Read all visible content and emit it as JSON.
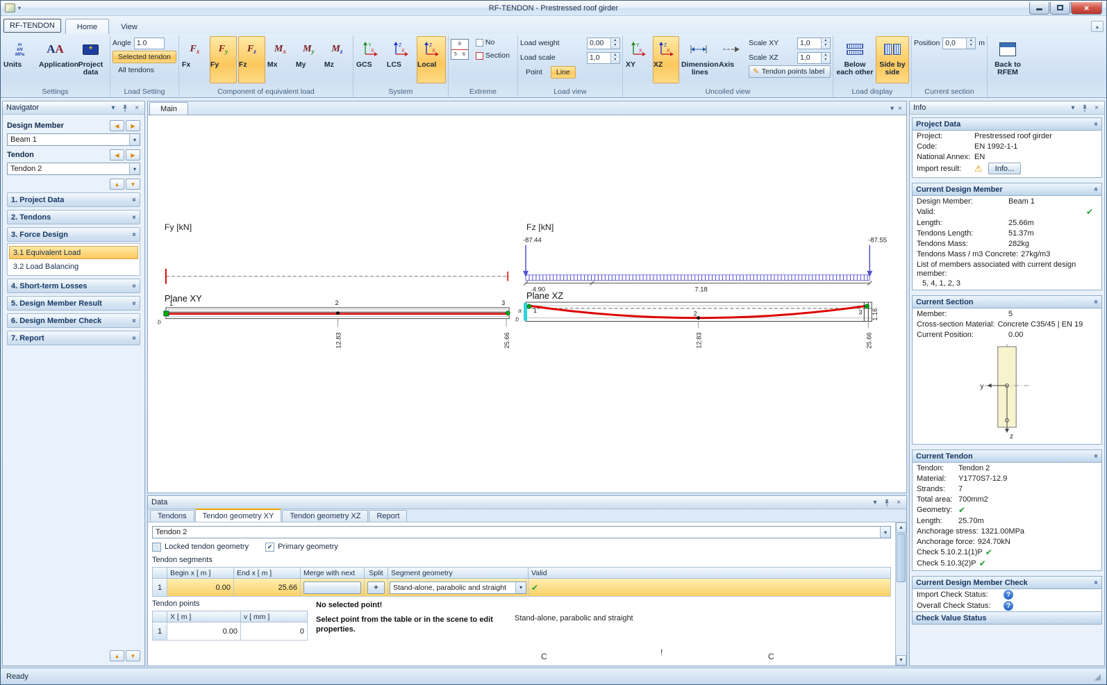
{
  "icons": {
    "chevron_down": "▾",
    "chevron_up": "▴",
    "close": "×",
    "check": "✔",
    "warning": "⚠",
    "question": "?",
    "plus": "+",
    "spin_up": "▴",
    "spin_down": "▾",
    "nav_left": "◀",
    "nav_right": "▶",
    "nav_up": "▲",
    "nav_down": "▼",
    "chevron_double": "»",
    "grip": "◢",
    "pencil": "✎",
    "star": "*"
  },
  "titlebar": {
    "title": "RF-TENDON - Prestressed roof girder"
  },
  "ribbon": {
    "app_button": "RF-TENDON",
    "tabs": [
      {
        "label": "Home"
      },
      {
        "label": "View"
      }
    ],
    "settings": {
      "label": "Settings",
      "units": "Units",
      "application": "Application",
      "project_data": "Project data",
      "units_icon_lines": [
        "m",
        "kN",
        "MPa"
      ],
      "app_icon_a1": "A",
      "app_icon_a2": "A"
    },
    "load_setting": {
      "label": "Load Setting",
      "angle_label": "Angle",
      "angle_value": "1.0",
      "selected_tendon": "Selected tendon",
      "all_tendons": "All tendons"
    },
    "component": {
      "label": "Component of equivalent load",
      "buttons": [
        {
          "label": "Fx",
          "icon_main": "F",
          "icon_sub": "x"
        },
        {
          "label": "Fy",
          "icon_main": "F",
          "icon_sub": "y"
        },
        {
          "label": "Fz",
          "icon_main": "F",
          "icon_sub": "z"
        },
        {
          "label": "Mx",
          "icon_main": "M",
          "icon_sub": "x"
        },
        {
          "label": "My",
          "icon_main": "M",
          "icon_sub": "y"
        },
        {
          "label": "Mz",
          "icon_main": "M",
          "icon_sub": "z"
        }
      ]
    },
    "system": {
      "label": "System",
      "gcs": "GCS",
      "lcs": "LCS",
      "local": "Local",
      "gcs_axes": {
        "v": "Y",
        "h": "X"
      },
      "lcs_axes": {
        "v": "Z",
        "h": "X"
      },
      "local_axes": {
        "v": "Z",
        "h": "X"
      }
    },
    "extreme": {
      "label": "Extreme",
      "no": "No",
      "section": "Section",
      "icon_numbers": [
        "8",
        "5",
        "6"
      ]
    },
    "load_view": {
      "label": "Load view",
      "load_weight_label": "Load weight",
      "load_weight_value": "0,00",
      "load_scale_label": "Load scale",
      "load_scale_value": "1,0",
      "point": "Point",
      "line": "Line"
    },
    "uncoiled_view": {
      "label": "Uncoiled view",
      "xy": "XY",
      "xz": "XZ",
      "xy_axes": {
        "v": "Y",
        "h": "X"
      },
      "xz_axes": {
        "v": "Z",
        "h": "X"
      },
      "dimension_lines": "Dimension lines",
      "axis": "Axis",
      "scale_xy_label": "Scale XY",
      "scale_xy_value": "1,0",
      "scale_xz_label": "Scale XZ",
      "scale_xz_value": "1,0",
      "tendon_points_label": "Tendon points label"
    },
    "load_display": {
      "label": "Load display",
      "below": "Below each other",
      "side": "Side by side"
    },
    "current_section": {
      "label": "Current section",
      "position_label": "Position",
      "position_value": "0,0",
      "unit": "m"
    },
    "back_to_rfem": "Back to RFEM"
  },
  "navigator": {
    "title": "Navigator",
    "design_member_label": "Design Member",
    "design_member_value": "Beam 1",
    "tendon_label": "Tendon",
    "tendon_value": "Tendon 2",
    "items": [
      {
        "label": "1. Project Data"
      },
      {
        "label": "2. Tendons"
      },
      {
        "label": "3. Force Design"
      },
      {
        "label": "4. Short-term Losses"
      },
      {
        "label": "5. Design Member Result"
      },
      {
        "label": "6. Design Member Check"
      },
      {
        "label": "7. Report"
      }
    ],
    "subitems": [
      {
        "label": "3.1 Equivalent Load"
      },
      {
        "label": "3.2 Load Balancing"
      }
    ]
  },
  "main": {
    "tab": "Main",
    "scene": {
      "fy_axis_label": "Fy [kN]",
      "fz_axis_label": "Fz [kN]",
      "plane_xy_label": "Plane XY",
      "plane_xz_label": "Plane XZ",
      "force_left": "-87.44",
      "force_right": "-87.55",
      "dim_a": "4.90",
      "dim_b": "7.18",
      "xy_dim_mid": "12.83",
      "xy_dim_end": "25.66",
      "xz_dim_mid": "12.83",
      "xz_dim_end": "25.66",
      "xy_pt1": "1",
      "xy_pt2": "2",
      "xy_pt3": "3",
      "xz_pt1": "1",
      "xz_pt2": "2",
      "xz_pt3": "3",
      "xy_marker_b": "b",
      "xz_marker_a": "a",
      "xz_marker_b": "b",
      "xz_end_dim": "1.16"
    }
  },
  "data_panel": {
    "title": "Data",
    "tabs": [
      {
        "label": "Tendons"
      },
      {
        "label": "Tendon geometry XY"
      },
      {
        "label": "Tendon geometry XZ"
      },
      {
        "label": "Report"
      }
    ],
    "tendon_select": "Tendon 2",
    "locked_checkbox": "Locked tendon geometry",
    "primary_checkbox": "Primary geometry",
    "segments_label": "Tendon segments",
    "segments_headers": {
      "begin": "Begin x  [ m ]",
      "end": "End x  [ m ]",
      "merge": "Merge with next",
      "split": "Split",
      "geometry": "Segment geometry",
      "valid": "Valid"
    },
    "segments_row": {
      "num": "1",
      "begin": "0.00",
      "end": "25.66",
      "split": "+",
      "geometry": "Stand-alone, parabolic and straight"
    },
    "points_label": "Tendon points",
    "points_headers": {
      "x": "X  [ m ]",
      "v": "v  [ mm ]"
    },
    "points_row": {
      "num": "1",
      "x": "0.00",
      "v": "0"
    },
    "no_point_title": "No selected point!",
    "no_point_text": "Select point from the table or in the scene to edit properties.",
    "geometry_note": "Stand-alone, parabolic and straight",
    "marks": [
      "C",
      "!",
      "C"
    ]
  },
  "info": {
    "title": "Info",
    "project": {
      "header": "Project Data",
      "rows": [
        {
          "label": "Project:",
          "value": "Prestressed roof girder"
        },
        {
          "label": "Code:",
          "value": "EN 1992-1-1"
        },
        {
          "label": "National Annex:",
          "value": "EN"
        }
      ],
      "import_label": "Import result:",
      "info_button": "Info..."
    },
    "member": {
      "header": "Current Design Member",
      "rows": [
        {
          "label": "Design Member: ",
          "value": "Beam 1"
        },
        {
          "label": "Length:",
          "value": "25.66m"
        },
        {
          "label": "Tendons Length:",
          "value": "51.37m"
        },
        {
          "label": "Tendons Mass:",
          "value": "282kg"
        },
        {
          "label": "Tendons Mass / m3 Concrete:",
          "value": "27kg/m3"
        }
      ],
      "valid_label": "Valid:",
      "list_label": "List of members associated with current design member:",
      "list_value": "5, 4, 1, 2, 3"
    },
    "section": {
      "header": "Current Section",
      "member_label": "Member:",
      "member_value": "5",
      "material_label": "Cross-section Material:",
      "material_value": "Concrete C35/45 | EN 19",
      "position_label": "Current Position:",
      "position_value": "0.00",
      "axis_y": "y",
      "axis_z": "z"
    },
    "tendon": {
      "header": "Current Tendon",
      "rows": [
        {
          "label": "Tendon:",
          "value": "Tendon 2"
        },
        {
          "label": "Material:",
          "value": "Y1770S7-12.9"
        },
        {
          "label": "Strands:",
          "value": "7"
        },
        {
          "label": "Total area:",
          "value": "700mm2"
        }
      ],
      "geometry_label": "Geometry:",
      "rows2": [
        {
          "label": "Length:",
          "value": "25.70m"
        },
        {
          "label": "Anchorage stress:",
          "value": "1321.00MPa"
        },
        {
          "label": "Anchorage force:",
          "value": "924.70kN"
        }
      ],
      "check1_label": "Check 5.10.2.1(1)P",
      "check2_label": "Check 5.10.3(2)P"
    },
    "check": {
      "header": "Current Design Member Check",
      "import_label": "Import Check Status:",
      "overall_label": "Overall Check Status:",
      "value_status": "Check Value Status"
    }
  },
  "statusbar": {
    "ready": "Ready"
  }
}
